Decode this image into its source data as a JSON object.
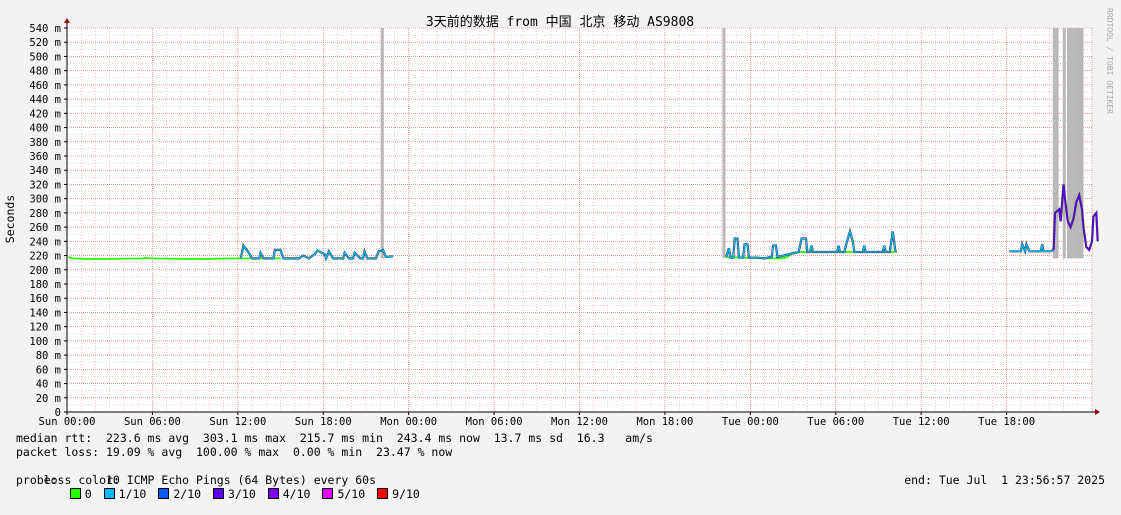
{
  "watermark": "RRDTOOL / TOBI OETIKER",
  "colors": {
    "loss_0": "#26ff00",
    "loss_1": "#00b8ff",
    "loss_2": "#0059ff",
    "loss_3": "#5e00ff",
    "loss_4": "#7e00ff",
    "loss_5": "#dd00ff",
    "loss_9": "#ff0000",
    "grid_minor": "#e8a8a8",
    "grid_major": "#e06060",
    "smoke": "#b8b8b8"
  },
  "chart_data": {
    "type": "line",
    "title": "3天前的数据 from 中国 北京 移动 AS9808",
    "ylabel": "Seconds",
    "ylim": [
      0,
      540
    ],
    "y_ticks": [
      "0",
      "20 m",
      "40 m",
      "60 m",
      "80 m",
      "100 m",
      "120 m",
      "140 m",
      "160 m",
      "180 m",
      "200 m",
      "220 m",
      "240 m",
      "260 m",
      "280 m",
      "300 m",
      "320 m",
      "340 m",
      "360 m",
      "380 m",
      "400 m",
      "420 m",
      "440 m",
      "460 m",
      "480 m",
      "500 m",
      "520 m",
      "540 m"
    ],
    "xlim_hours": [
      0,
      72
    ],
    "x_ticks": [
      {
        "h": 0,
        "label": "Sun 00:00"
      },
      {
        "h": 6,
        "label": "Sun 06:00"
      },
      {
        "h": 12,
        "label": "Sun 12:00"
      },
      {
        "h": 18,
        "label": "Sun 18:00"
      },
      {
        "h": 24,
        "label": "Mon 00:00"
      },
      {
        "h": 30,
        "label": "Mon 06:00"
      },
      {
        "h": 36,
        "label": "Mon 12:00"
      },
      {
        "h": 42,
        "label": "Mon 18:00"
      },
      {
        "h": 48,
        "label": "Tue 00:00"
      },
      {
        "h": 54,
        "label": "Tue 06:00"
      },
      {
        "h": 60,
        "label": "Tue 12:00"
      },
      {
        "h": 66,
        "label": "Tue 18:00"
      }
    ],
    "segments": [
      {
        "loss": "0",
        "points": [
          [
            0.1,
            218
          ],
          [
            0.4,
            216
          ],
          [
            2,
            215
          ],
          [
            5.3,
            216
          ],
          [
            5.5,
            217
          ],
          [
            5.8,
            216
          ],
          [
            9.5,
            215
          ],
          [
            11.3,
            216
          ],
          [
            12.2,
            216
          ],
          [
            15,
            216
          ]
        ]
      },
      {
        "loss": "1/10",
        "points": [
          [
            12.2,
            216
          ],
          [
            12.4,
            234
          ],
          [
            12.7,
            226
          ],
          [
            13,
            216
          ],
          [
            13.5,
            216
          ],
          [
            13.6,
            224
          ],
          [
            13.8,
            216
          ],
          [
            14.5,
            216
          ],
          [
            14.6,
            228
          ],
          [
            15,
            228
          ],
          [
            15.2,
            216
          ],
          [
            16.3,
            216
          ],
          [
            16.6,
            220
          ],
          [
            17,
            216
          ],
          [
            17.4,
            222
          ],
          [
            17.6,
            227
          ],
          [
            18.1,
            222
          ],
          [
            18.2,
            216
          ],
          [
            18.4,
            226
          ],
          [
            18.7,
            216
          ],
          [
            19.4,
            216
          ],
          [
            19.5,
            224
          ],
          [
            19.8,
            216
          ],
          [
            20.1,
            216
          ],
          [
            20.2,
            224
          ],
          [
            20.6,
            216
          ],
          [
            20.8,
            216
          ],
          [
            20.9,
            226
          ],
          [
            21.1,
            216
          ],
          [
            21.7,
            216
          ],
          [
            21.9,
            226
          ],
          [
            22.2,
            228
          ],
          [
            22.4,
            218
          ],
          [
            22.9,
            219
          ]
        ]
      },
      {
        "loss": "0",
        "points": [
          [
            46.3,
            218
          ],
          [
            49,
            216
          ],
          [
            50.2,
            216
          ],
          [
            50.6,
            218
          ],
          [
            51,
            224
          ],
          [
            51.5,
            225
          ],
          [
            55.3,
            225
          ],
          [
            58.3,
            225
          ]
        ]
      },
      {
        "loss": "1/10",
        "points": [
          [
            46.3,
            218
          ],
          [
            46.5,
            230
          ],
          [
            46.6,
            217
          ],
          [
            46.8,
            217
          ],
          [
            46.9,
            244
          ],
          [
            47.1,
            244
          ],
          [
            47.2,
            217
          ],
          [
            47.5,
            217
          ],
          [
            47.6,
            236
          ],
          [
            47.8,
            236
          ],
          [
            47.9,
            217
          ],
          [
            48.5,
            217
          ],
          [
            49,
            216
          ],
          [
            49.4,
            218
          ],
          [
            49.5,
            218
          ],
          [
            49.6,
            234
          ],
          [
            49.8,
            234
          ],
          [
            49.9,
            218
          ],
          [
            51.4,
            225
          ],
          [
            51.6,
            244
          ],
          [
            51.9,
            244
          ],
          [
            52,
            225
          ],
          [
            52.2,
            225
          ],
          [
            52.3,
            234
          ],
          [
            52.4,
            225
          ],
          [
            54.1,
            225
          ],
          [
            54.2,
            234
          ],
          [
            54.3,
            225
          ],
          [
            54.6,
            225
          ],
          [
            54.8,
            240
          ],
          [
            55,
            254
          ],
          [
            55.2,
            240
          ],
          [
            55.3,
            225
          ],
          [
            55.9,
            225
          ],
          [
            56,
            234
          ],
          [
            56.1,
            225
          ],
          [
            57.3,
            225
          ],
          [
            57.4,
            234
          ],
          [
            57.5,
            225
          ],
          [
            57.8,
            225
          ],
          [
            57.9,
            240
          ],
          [
            58,
            254
          ],
          [
            58.1,
            240
          ],
          [
            58.2,
            225
          ]
        ]
      },
      {
        "loss": "1/10",
        "points": [
          [
            66.2,
            226
          ],
          [
            67,
            226
          ],
          [
            67.1,
            236
          ],
          [
            67.3,
            226
          ],
          [
            67.4,
            236
          ],
          [
            67.6,
            226
          ],
          [
            68.4,
            226
          ],
          [
            68.5,
            236
          ],
          [
            68.6,
            226
          ],
          [
            69.1,
            226
          ],
          [
            69.3,
            228
          ]
        ]
      },
      {
        "loss": "3/10",
        "points": [
          [
            69.3,
            228
          ],
          [
            69.4,
            280
          ],
          [
            69.7,
            285
          ],
          [
            69.8,
            268
          ],
          [
            70,
            320
          ],
          [
            70.1,
            300
          ],
          [
            70.3,
            268
          ],
          [
            70.5,
            260
          ],
          [
            70.7,
            272
          ],
          [
            70.9,
            295
          ],
          [
            71.1,
            305
          ],
          [
            71.3,
            285
          ],
          [
            71.4,
            260
          ],
          [
            71.6,
            232
          ],
          [
            71.8,
            228
          ],
          [
            72,
            240
          ],
          [
            72.1,
            275
          ],
          [
            72.3,
            280
          ],
          [
            72.4,
            240
          ]
        ]
      }
    ],
    "smoke_spikes_hours": [
      22.15,
      46.15,
      69.35,
      69.55,
      70.05,
      70.35,
      70.55,
      70.75,
      70.95,
      71.15,
      71.3
    ],
    "legend": [
      {
        "key": "loss_0",
        "label": "0"
      },
      {
        "key": "loss_1",
        "label": "1/10"
      },
      {
        "key": "loss_2",
        "label": "2/10"
      },
      {
        "key": "loss_3",
        "label": "3/10"
      },
      {
        "key": "loss_4",
        "label": "4/10"
      },
      {
        "key": "loss_5",
        "label": "5/10"
      },
      {
        "key": "loss_9",
        "label": "9/10"
      }
    ]
  },
  "stats": {
    "median_rtt": "median rtt:  223.6 ms avg  303.1 ms max  215.7 ms min  243.4 ms now  13.7 ms sd  16.3   am/s",
    "packet_loss": "packet loss: 19.09 % avg  100.00 % max  0.00 % min  23.47 % now",
    "loss_color_label": "loss color:",
    "probe": "probe:       10 ICMP Echo Pings (64 Bytes) every 60s",
    "end": "end: Tue Jul  1 23:56:57 2025"
  }
}
